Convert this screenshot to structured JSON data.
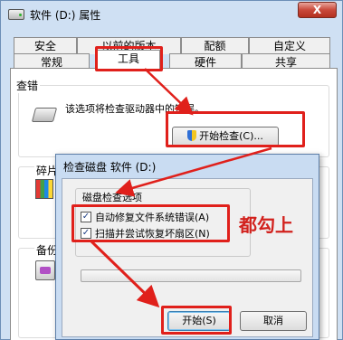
{
  "window": {
    "title": "软件 (D:) 属性",
    "close_label": "X"
  },
  "tabs_top": [
    "安全",
    "以前的版本",
    "配额",
    "自定义"
  ],
  "tabs_bottom": [
    "常规",
    "工具",
    "硬件",
    "共享"
  ],
  "error_check": {
    "group_title": "查错",
    "description": "该选项将检查驱动器中的错误。",
    "button_label": "开始检查(C)..."
  },
  "defrag": {
    "group_title": "碎片"
  },
  "backup": {
    "group_title": "备份"
  },
  "dialog": {
    "title": "检查磁盘 软件 (D:)",
    "group_title": "磁盘检查选项",
    "options": [
      {
        "label": "自动修复文件系统错误(A)",
        "checked": true
      },
      {
        "label": "扫描并尝试恢复坏扇区(N)",
        "checked": true
      }
    ],
    "progress": 0,
    "start_label": "开始(S)",
    "cancel_label": "取消"
  },
  "annotation": "都勾上",
  "colors": {
    "highlight": "#e0201b",
    "annotation": "#d2211d"
  }
}
